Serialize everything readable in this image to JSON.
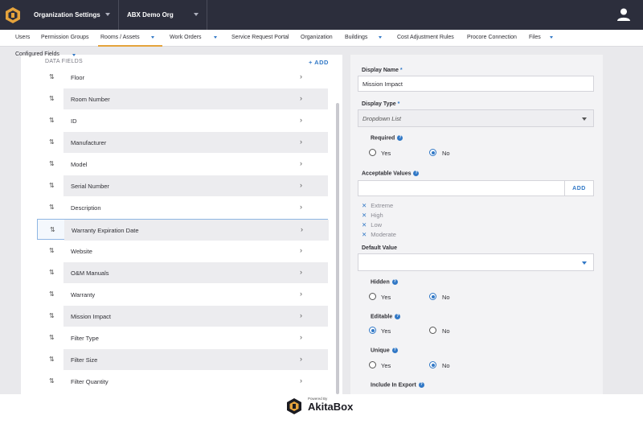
{
  "header": {
    "org_settings": "Organization Settings",
    "org_name": "ABX Demo Org"
  },
  "nav": {
    "users": "Users",
    "permission_groups": "Permission Groups",
    "rooms_assets": "Rooms / Assets",
    "work_orders": "Work Orders",
    "service_request_portal": "Service Request Portal",
    "organization": "Organization",
    "buildings": "Buildings",
    "cost_adjustment_rules": "Cost Adjustment Rules",
    "procore_connection": "Procore Connection",
    "files": "Files"
  },
  "subnav": {
    "configured_fields": "Configured Fields"
  },
  "data_fields": {
    "heading": "DATA FIELDS",
    "add_label": "+ ADD",
    "rows": [
      "Floor",
      "Room Number",
      "ID",
      "Manufacturer",
      "Model",
      "Serial Number",
      "Description",
      "Warranty Expiration Date",
      "Website",
      "O&M Manuals",
      "Warranty",
      "Mission Impact",
      "Filter Type",
      "Filter Size",
      "Filter Quantity"
    ]
  },
  "form": {
    "display_name_label": "Display Name",
    "required_mark": "*",
    "display_name_value": "Mission Impact",
    "display_type_label": "Display Type",
    "display_type_value": "Dropdown List",
    "required_label": "Required",
    "yes": "Yes",
    "no": "No",
    "acceptable_values_label": "Acceptable Values",
    "add_value_label": "ADD",
    "values": [
      "Extreme",
      "High",
      "Low",
      "Moderate"
    ],
    "default_value_label": "Default Value",
    "hidden_label": "Hidden",
    "editable_label": "Editable",
    "unique_label": "Unique",
    "include_in_export_label": "Include In Export",
    "required_selected": "No",
    "hidden_selected": "No",
    "editable_selected": "Yes",
    "unique_selected": "No"
  },
  "footer": {
    "powered_by": "Powered By",
    "brand": "AkitaBox"
  },
  "colors": {
    "topbar": "#2c2e3c",
    "accent": "#3178c6",
    "tab_underline": "#e5a33c"
  }
}
